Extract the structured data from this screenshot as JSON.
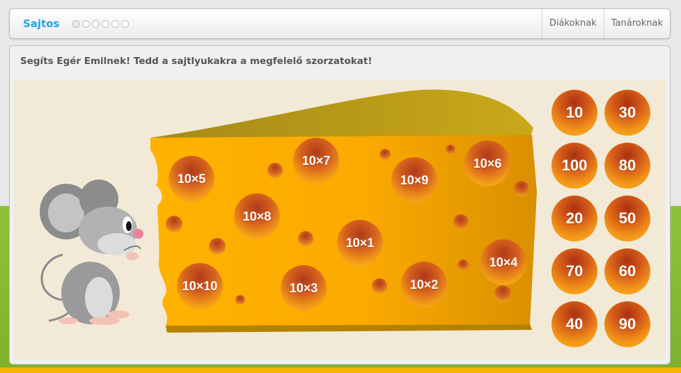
{
  "header": {
    "app_title": "Sajtos",
    "progress_dots_total": 6,
    "progress_dots_active": 1,
    "nav": [
      {
        "label": "Diákoknak"
      },
      {
        "label": "Tanároknak"
      }
    ]
  },
  "instruction": "Segíts Egér Emilnek! Tedd a sajtlyukakra a megfelelő szorzatokat!",
  "cheese_holes": [
    {
      "label": "10×5"
    },
    {
      "label": "10×7"
    },
    {
      "label": "10×9"
    },
    {
      "label": "10×6"
    },
    {
      "label": "10×8"
    },
    {
      "label": "10×1"
    },
    {
      "label": "10×4"
    },
    {
      "label": "10×10"
    },
    {
      "label": "10×3"
    },
    {
      "label": "10×2"
    }
  ],
  "answers": [
    {
      "label": "10"
    },
    {
      "label": "30"
    },
    {
      "label": "100"
    },
    {
      "label": "80"
    },
    {
      "label": "20"
    },
    {
      "label": "50"
    },
    {
      "label": "70"
    },
    {
      "label": "60"
    },
    {
      "label": "40"
    },
    {
      "label": "90"
    }
  ],
  "colors": {
    "accent": "#1ea7e0",
    "cheese": "#f7a600",
    "hole_dark": "#b03a1a",
    "background_green": "#8fc13a"
  }
}
